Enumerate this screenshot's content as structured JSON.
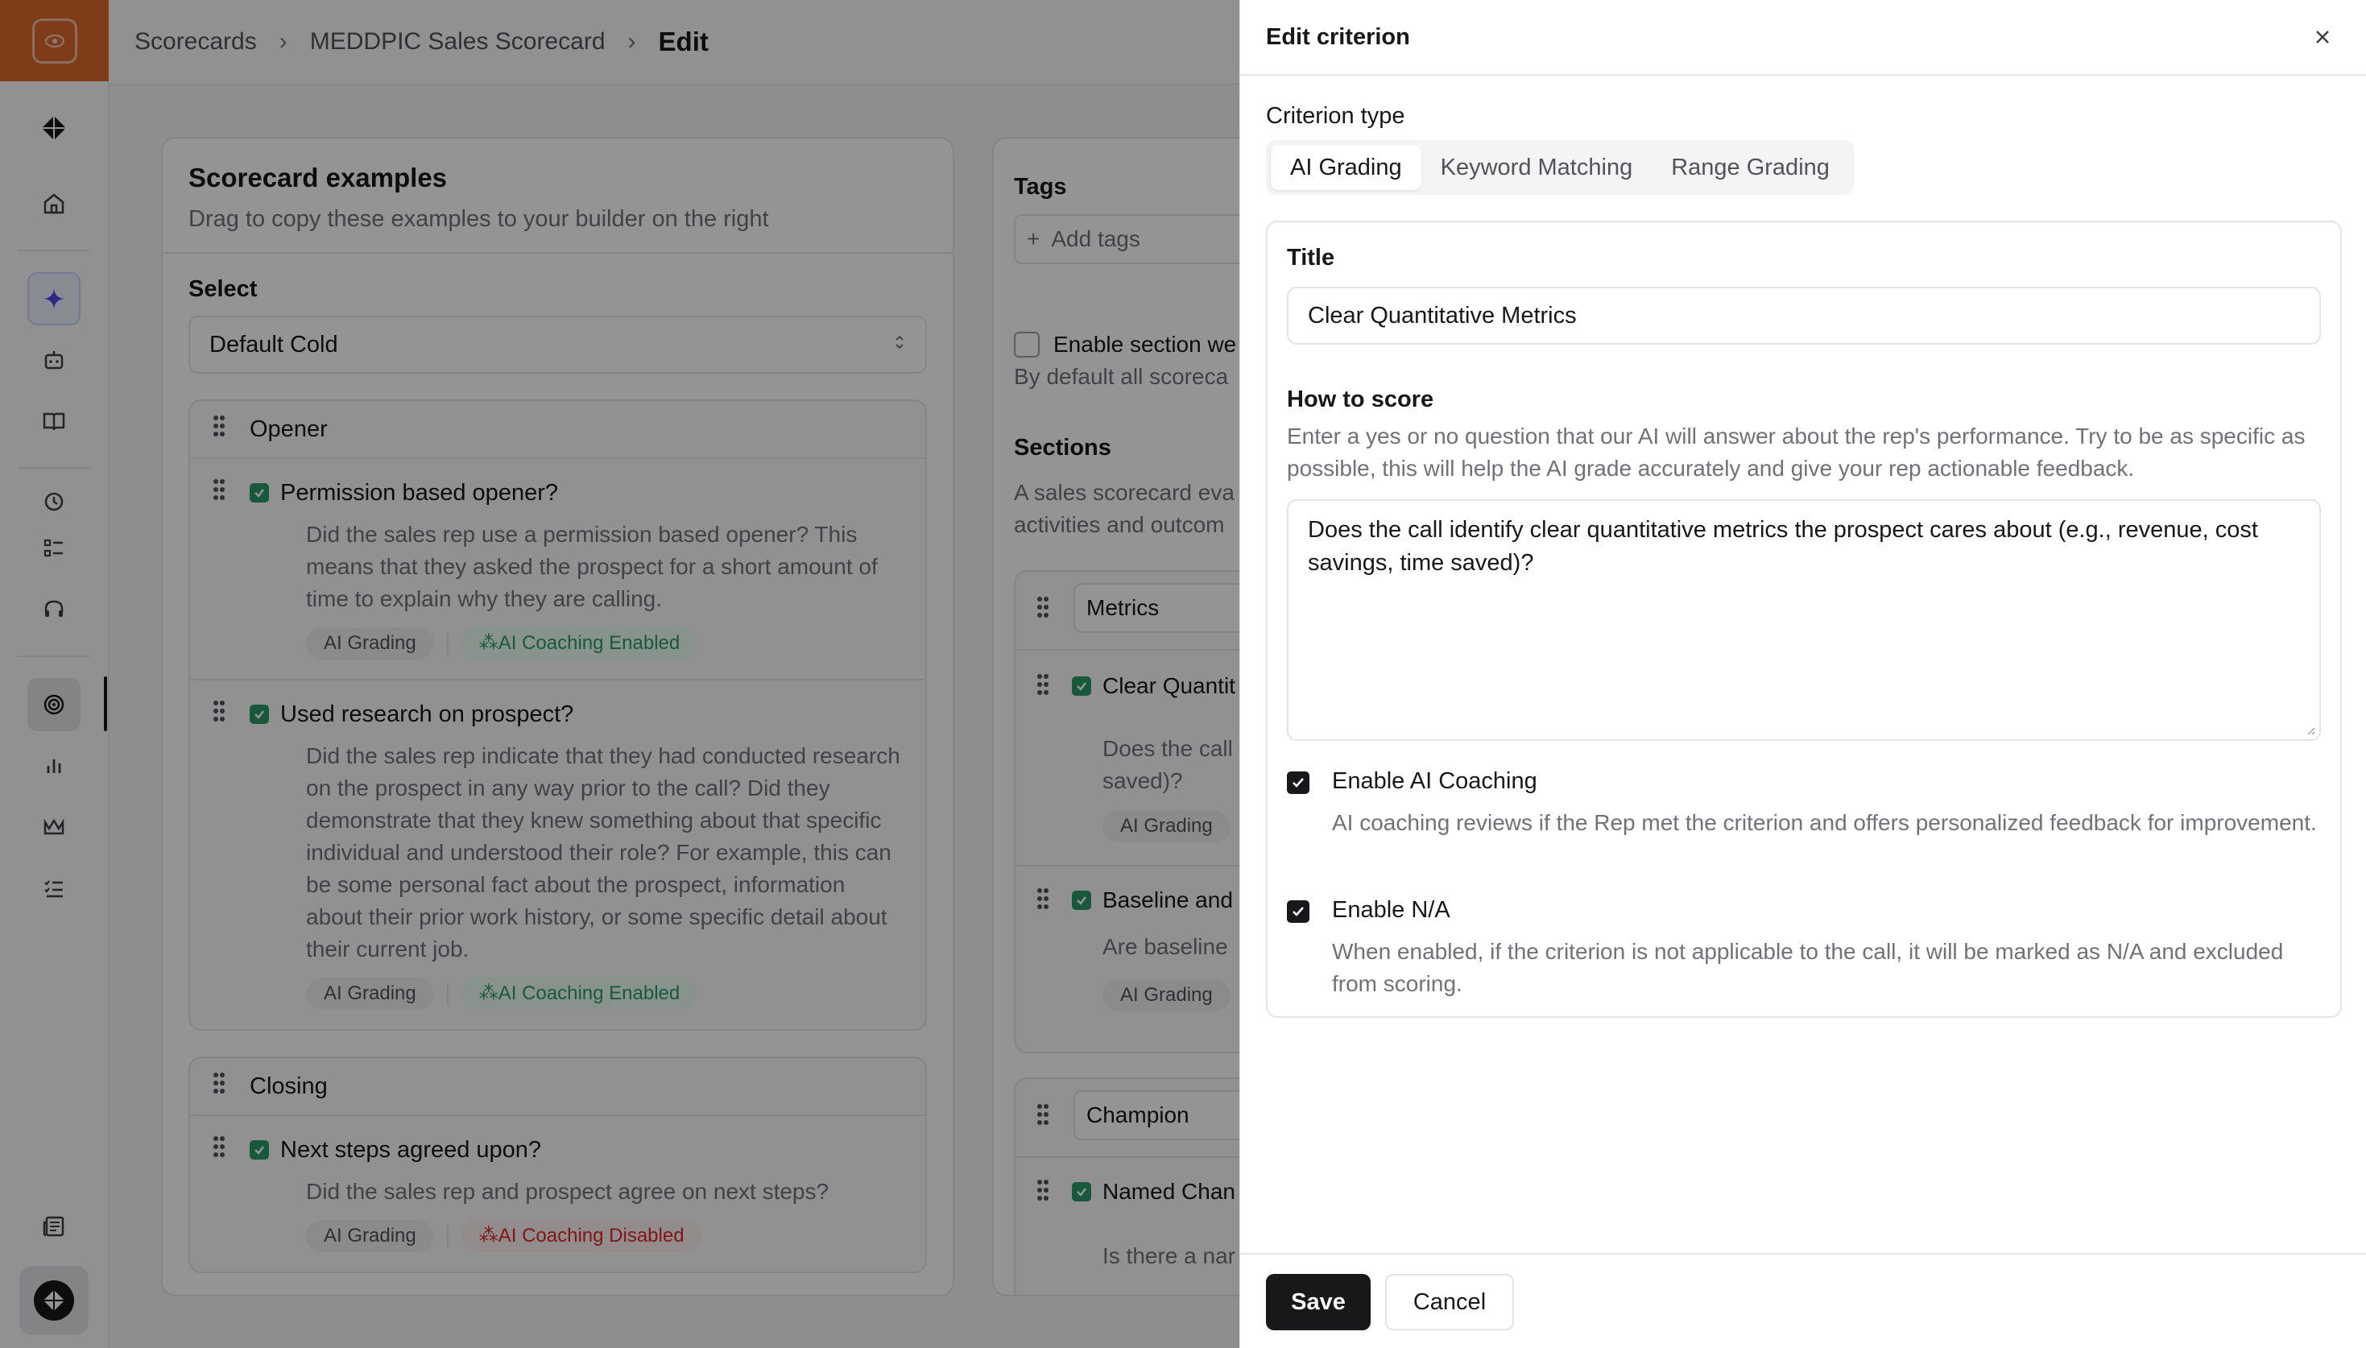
{
  "breadcrumb": {
    "items": [
      "Scorecards",
      "MEDDPIC Sales Scorecard"
    ],
    "current": "Edit"
  },
  "sidebar": {
    "icons": [
      "eye-icon",
      "brand-logo-icon",
      "home-icon",
      "sparkle-icon",
      "bot-icon",
      "book-icon",
      "history-icon",
      "list-icon",
      "headset-icon",
      "target-icon",
      "bar-chart-icon",
      "crown-icon",
      "checklist-icon",
      "newspaper-icon",
      "brand-logo-icon"
    ]
  },
  "examples": {
    "title": "Scorecard examples",
    "subtitle": "Drag to copy these examples to your builder on the right",
    "select_label": "Select",
    "select_value": "Default Cold",
    "sections": [
      {
        "name": "Opener",
        "criteria": [
          {
            "title": "Permission based opener?",
            "desc": "Did the sales rep use a permission based opener? This means that they asked the prospect for a short amount of time to explain why they are calling.",
            "grading": "AI Grading",
            "coaching": "AI Coaching Enabled"
          },
          {
            "title": "Used research on prospect?",
            "desc": "Did the sales rep indicate that they had conducted research on the prospect in any way prior to the call? Did they demonstrate that they knew something about that specific individual and understood their role? For example, this can be some personal fact about the prospect, information about their prior work history, or some specific detail about their current job.",
            "grading": "AI Grading",
            "coaching": "AI Coaching Enabled"
          }
        ]
      },
      {
        "name": "Closing",
        "criteria": [
          {
            "title": "Next steps agreed upon?",
            "desc": "Did the sales rep and prospect agree on next steps?",
            "grading": "AI Grading",
            "coaching": "AI Coaching Disabled"
          }
        ]
      }
    ]
  },
  "builder": {
    "tags_label": "Tags",
    "tags_placeholder": "Add tags",
    "section_weight_label": "Enable section we",
    "section_weight_help": "By default all scoreca",
    "sections_label": "Sections",
    "sections_help_1": "A sales scorecard eva",
    "sections_help_2": "activities and outcom",
    "section1": {
      "name": "Metrics",
      "c1_title": "Clear Quantit",
      "c1_desc_1": "Does the call",
      "c1_desc_2": "saved)?",
      "c1_grading": "AI Grading",
      "c2_title": "Baseline and",
      "c2_desc": "Are baseline",
      "c2_grading": "AI Grading"
    },
    "section2": {
      "name": "Champion",
      "c1_title": "Named Chan",
      "c1_desc": "Is there a nar"
    }
  },
  "drawer": {
    "title": "Edit criterion",
    "criterion_type_label": "Criterion type",
    "tabs": [
      "AI Grading",
      "Keyword Matching",
      "Range Grading"
    ],
    "active_tab": "AI Grading",
    "title_label": "Title",
    "title_value": "Clear Quantitative Metrics",
    "how_label": "How to score",
    "how_help": "Enter a yes or no question that our AI will answer about the rep's performance. Try to be as specific as possible, this will help the AI grade accurately and give your rep actionable feedback.",
    "how_value": "Does the call identify clear quantitative metrics the prospect cares about (e.g., revenue, cost savings, time saved)?",
    "coaching_label": "Enable AI Coaching",
    "coaching_help": "AI coaching reviews if the Rep met the criterion and offers personalized feedback for improvement.",
    "na_label": "Enable N/A",
    "na_help": "When enabled, if the criterion is not applicable to the call, it will be marked as N/A and excluded from scoring.",
    "save": "Save",
    "cancel": "Cancel"
  },
  "colors": {
    "brand": "#d96a2a",
    "success": "#2b9a66",
    "danger": "#dc2626",
    "primary": "#18181b"
  }
}
